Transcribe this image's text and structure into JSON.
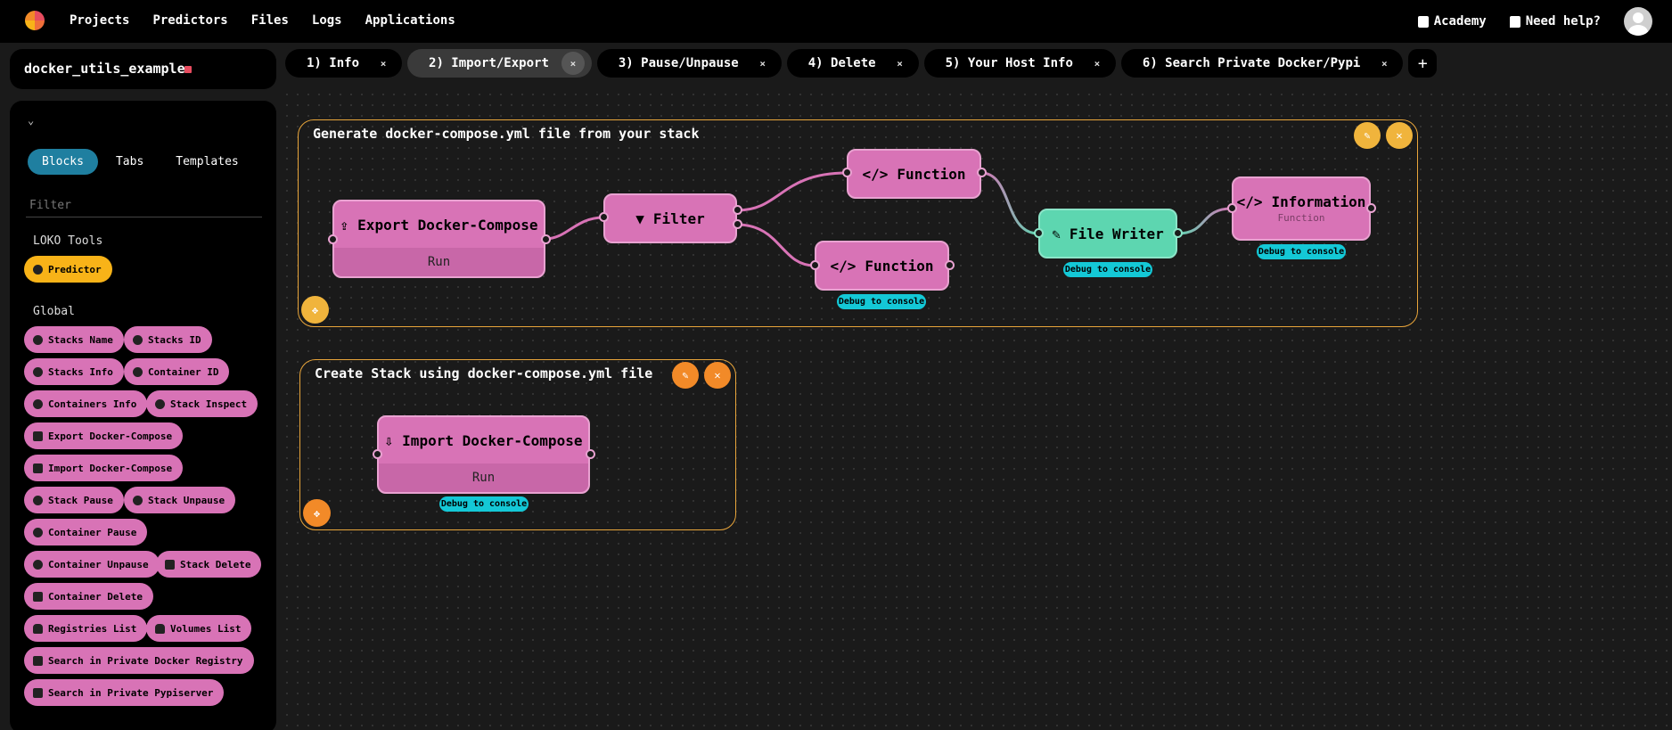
{
  "nav": {
    "links": [
      "Projects",
      "Predictors",
      "Files",
      "Logs",
      "Applications"
    ],
    "academy": "Academy",
    "help": "Need help?"
  },
  "project": {
    "name": "docker_utils_example"
  },
  "tabs": [
    {
      "label": "1) Info"
    },
    {
      "label": "2) Import/Export"
    },
    {
      "label": "3) Pause/Unpause"
    },
    {
      "label": "4) Delete"
    },
    {
      "label": "5) Your Host Info"
    },
    {
      "label": "6) Search Private Docker/Pypi"
    }
  ],
  "tab_add": "+",
  "tab_close": "×",
  "sidebar": {
    "chevron": "⌄",
    "segments": [
      "Blocks",
      "Tabs",
      "Templates"
    ],
    "filter_placeholder": "Filter",
    "loko_tools_title": "LOKO Tools",
    "predictor": "Predictor",
    "global_title": "Global",
    "blocks": [
      "Stacks Name",
      "Stacks ID",
      "Stacks Info",
      "Container ID",
      "Containers Info",
      "Stack Inspect",
      "Export Docker-Compose",
      "Import Docker-Compose",
      "Stack Pause",
      "Stack Unpause",
      "Container Pause",
      "Container Unpause",
      "Stack Delete",
      "Container Delete",
      "Registries List",
      "Volumes List",
      "Search in Private Docker Registry",
      "Search in Private Pypiserver"
    ]
  },
  "canvas": {
    "group1": {
      "title": "Generate docker-compose.yml file from your stack",
      "nodes": {
        "export": {
          "label": "Export Docker-Compose",
          "run": "Run"
        },
        "filter": {
          "label": "Filter"
        },
        "function_top": {
          "label": "Function"
        },
        "function_bottom": {
          "label": "Function",
          "debug": "Debug to console"
        },
        "file_writer": {
          "label": "File Writer",
          "debug": "Debug to console"
        },
        "information": {
          "label": "Information",
          "sub": "Function",
          "debug": "Debug to console"
        }
      }
    },
    "group2": {
      "title": "Create Stack using docker-compose.yml file",
      "nodes": {
        "import": {
          "label": "Import Docker-Compose",
          "run": "Run",
          "debug": "Debug to console"
        }
      }
    }
  },
  "colors": {
    "node_pink": "#d873b6",
    "node_green": "#5dd6b0",
    "group_border": "#e8a53b",
    "debug_badge": "#14c8d6",
    "segment_active": "#1f7fa0",
    "predictor": "#f8b318"
  }
}
